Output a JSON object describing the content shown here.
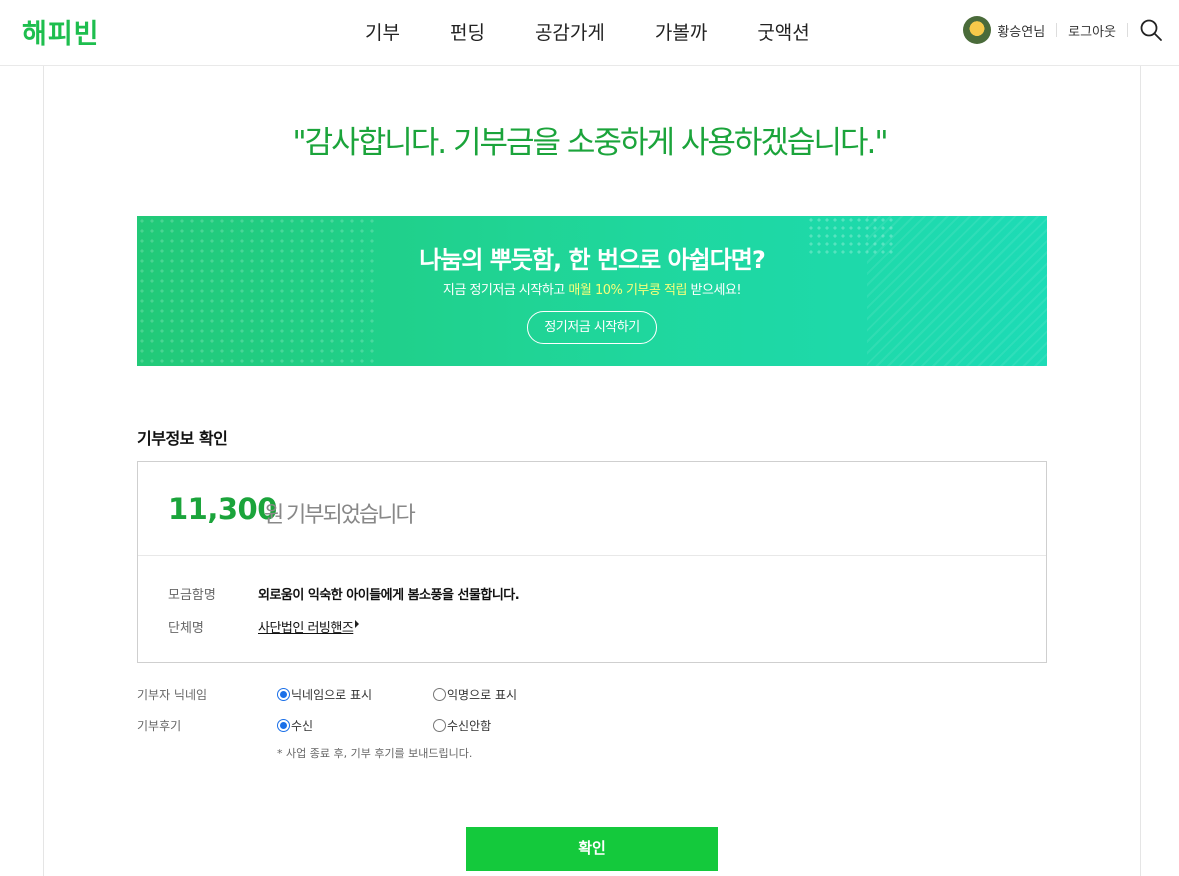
{
  "header": {
    "logo": "해피빈",
    "nav": [
      "기부",
      "펀딩",
      "공감가게",
      "가볼까",
      "굿액션"
    ],
    "user_nick": "황승연님",
    "logout_label": "로그아웃"
  },
  "main": {
    "thanks_message": "\"감사합니다. 기부금을 소중하게 사용하겠습니다.\""
  },
  "banner": {
    "title": "나눔의 뿌듯함, 한 번으로 아쉽다면?",
    "sub_prefix": "지금 정기저금 시작하고 ",
    "sub_highlight": "매월 10% 기부콩 적립",
    "sub_suffix": " 받으세요!",
    "button_label": "정기저금 시작하기"
  },
  "donation": {
    "section_title": "기부정보 확인",
    "amount": "11,300",
    "amount_unit": "원",
    "amount_message": "기부되었습니다",
    "campaign_label": "모금함명",
    "campaign_value": "외로움이 익숙한 아이들에게 봄소풍을 선물합니다.",
    "org_label": "단체명",
    "org_value": "사단법인 러빙핸즈"
  },
  "options": {
    "nickname_label": "기부자 닉네임",
    "nickname_choices": [
      "닉네임으로 표시",
      "익명으로 표시"
    ],
    "nickname_selected": "닉네임으로 표시",
    "review_label": "기부후기",
    "review_choices": [
      "수신",
      "수신안함"
    ],
    "review_selected": "수신",
    "note": "* 사업 종료 후, 기부 후기를 보내드립니다."
  },
  "confirm_label": "확인",
  "colors": {
    "brand": "#1ebe4e",
    "accent_green": "#1ba43b",
    "button_green": "#14c93c",
    "radio_blue": "#1a6fe8"
  }
}
